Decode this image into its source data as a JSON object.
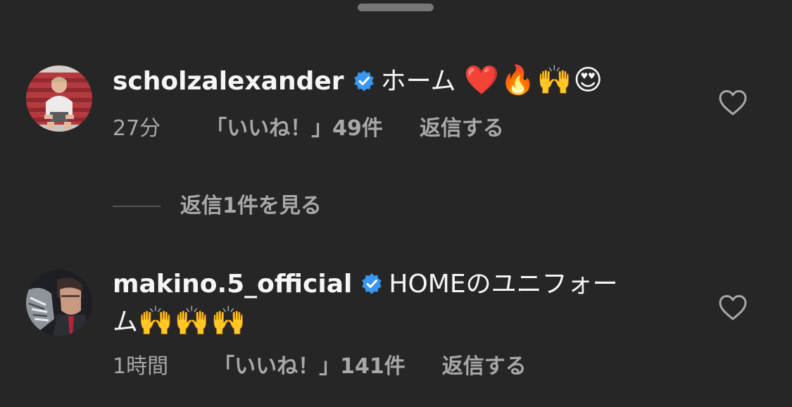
{
  "comments": [
    {
      "username": "scholzalexander",
      "text": "ホーム",
      "emojis": "❤️🔥🙌😍",
      "time": "27分",
      "likes": "「いいね！」49件",
      "reply": "返信する"
    },
    {
      "username": "makino.5_official",
      "text_line1": "HOMEのユニフォー",
      "text_line2": "ム",
      "emojis": "🙌🙌🙌",
      "time": "1時間",
      "likes": "「いいね！」141件",
      "reply": "返信する"
    }
  ],
  "view_replies": "返信1件を見る",
  "icons": {
    "verified": "verified-badge-icon",
    "like": "heart-outline-icon",
    "grabber": "sheet-grabber"
  },
  "colors": {
    "background": "#262626",
    "primary_text": "#f5f5f5",
    "secondary_text": "#a8a8a8",
    "verified_blue": "#3897f0"
  }
}
